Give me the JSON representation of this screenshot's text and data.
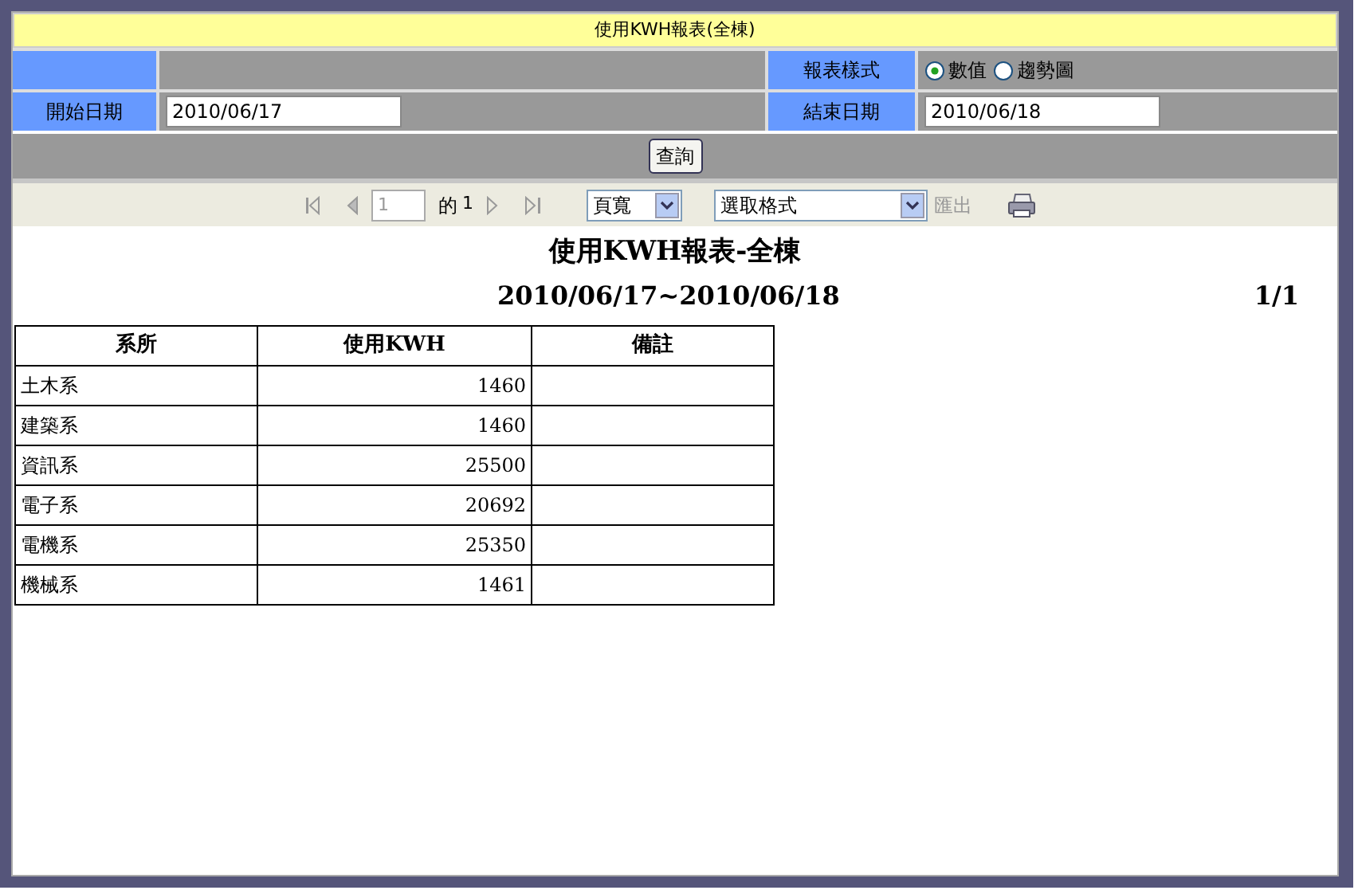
{
  "title": "使用KWH報表(全棟)",
  "form": {
    "style_label": "報表樣式",
    "style_options": [
      {
        "label": "數值",
        "selected": true
      },
      {
        "label": "趨勢圖",
        "selected": false
      }
    ],
    "start_label": "開始日期",
    "start_value": "2010/06/17",
    "end_label": "結束日期",
    "end_value": "2010/06/18",
    "query_button": "查詢"
  },
  "toolbar": {
    "page_value": "1",
    "page_of": "的",
    "page_total": "1",
    "zoom": "頁寬",
    "format": "選取格式",
    "export": "匯出"
  },
  "report": {
    "title": "使用KWH報表-全棟",
    "date_range": "2010/06/17~2010/06/18",
    "page_indicator": "1/1",
    "columns": [
      "系所",
      "使用KWH",
      "備註"
    ],
    "rows": [
      {
        "department": "土木系",
        "kwh": "1460"
      },
      {
        "department": "建築系",
        "kwh": "1460"
      },
      {
        "department": "資訊系",
        "kwh": "25500"
      },
      {
        "department": "電子系",
        "kwh": "20692"
      },
      {
        "department": "電機系",
        "kwh": "25350"
      },
      {
        "department": "機械系",
        "kwh": "1461"
      }
    ]
  }
}
